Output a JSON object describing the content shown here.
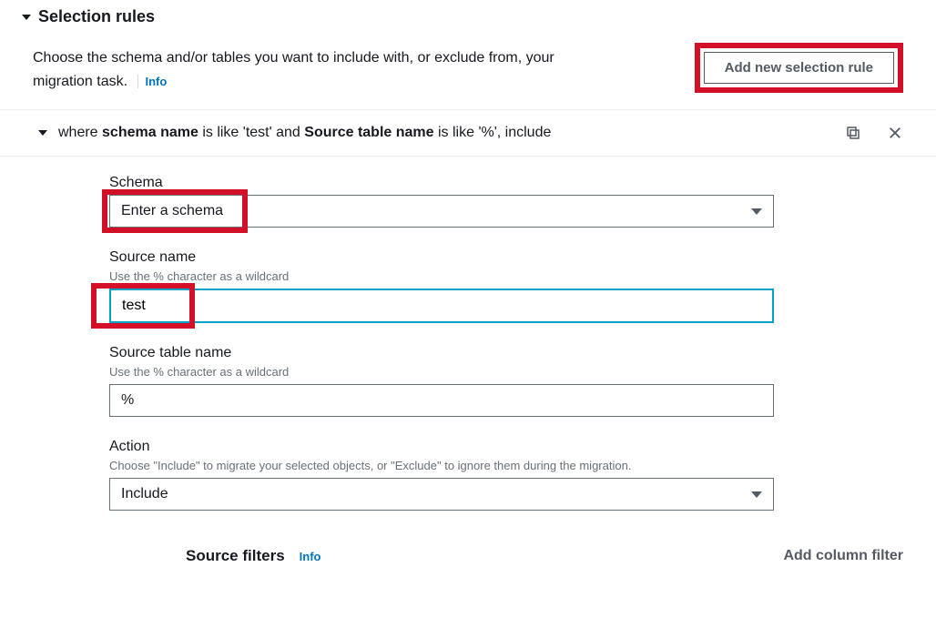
{
  "section": {
    "title": "Selection rules",
    "description": "Choose the schema and/or tables you want to include with, or exclude from, your migration task.",
    "info": "Info",
    "add_button": "Add new selection rule"
  },
  "rule": {
    "prefix": "where ",
    "schema_bold": "schema name",
    "mid1": " is like 'test' and ",
    "table_bold": "Source table name",
    "suffix": " is like '%', include"
  },
  "fields": {
    "schema": {
      "label": "Schema",
      "placeholder": "Enter a schema"
    },
    "source_name": {
      "label": "Source name",
      "hint": "Use the % character as a wildcard",
      "value": "test"
    },
    "source_table": {
      "label": "Source table name",
      "hint": "Use the % character as a wildcard",
      "value": "%"
    },
    "action": {
      "label": "Action",
      "hint": "Choose \"Include\" to migrate your selected objects, or \"Exclude\" to ignore them during the migration.",
      "value": "Include"
    }
  },
  "filters": {
    "title": "Source filters",
    "info": "Info",
    "add": "Add column filter"
  }
}
